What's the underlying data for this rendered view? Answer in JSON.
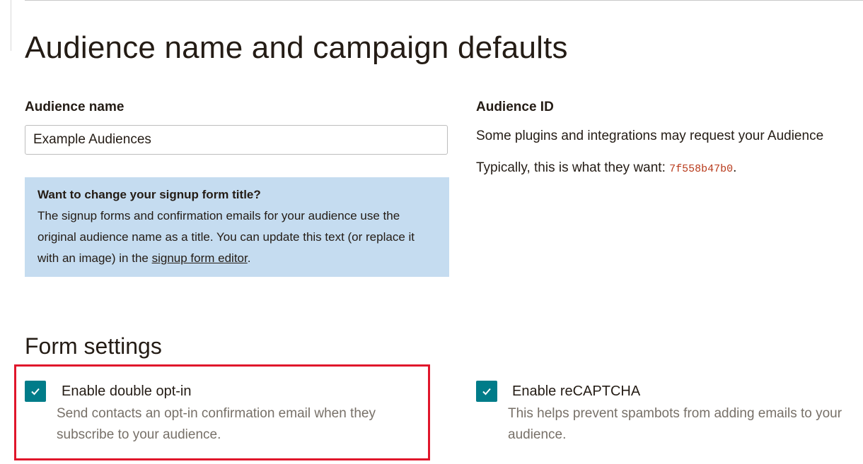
{
  "page": {
    "title": "Audience name and campaign defaults"
  },
  "audience_name": {
    "label": "Audience name",
    "value": "Example Audiences"
  },
  "info_box": {
    "title": "Want to change your signup form title?",
    "body_before_link": "The signup forms and confirmation emails for your audience use the original audience name as a title. You can update this text (or replace it with an image) in the ",
    "link_text": "signup form editor",
    "body_after_link": "."
  },
  "audience_id": {
    "label": "Audience ID",
    "description": "Some plugins and integrations may request your Audience",
    "typical_prefix": "Typically, this is what they want: ",
    "id_value": "7f558b47b0",
    "typical_suffix": "."
  },
  "form_settings": {
    "title": "Form settings",
    "double_optin": {
      "label": "Enable double opt-in",
      "help": "Send contacts an opt-in confirmation email when they subscribe to your audience.",
      "checked": true
    },
    "recaptcha": {
      "label": "Enable reCAPTCHA",
      "help": "This helps prevent spambots from adding emails to your audience.",
      "checked": true
    }
  },
  "colors": {
    "checkbox": "#007c89",
    "info_box_bg": "#c5dcf0",
    "id_code": "#b83a1b",
    "highlight_border": "#e0162b"
  }
}
